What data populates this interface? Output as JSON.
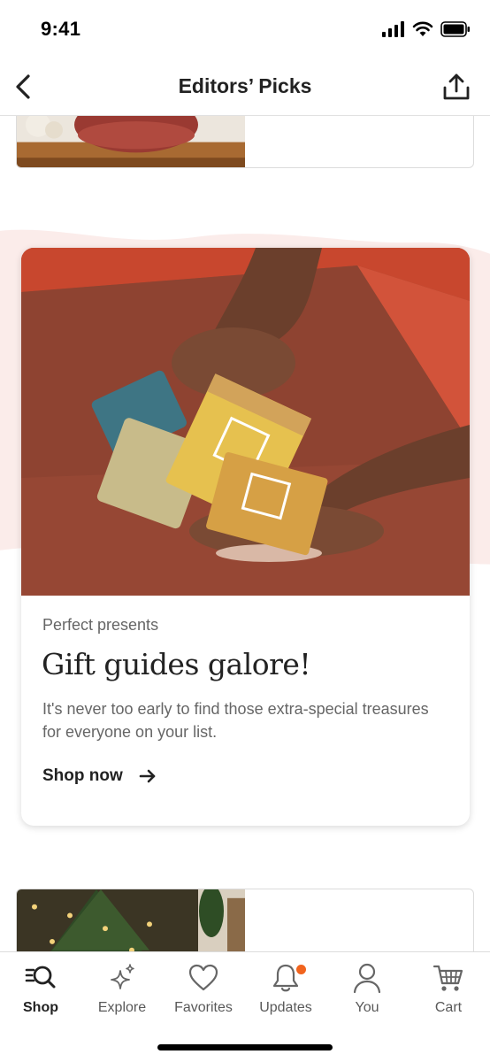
{
  "status_bar": {
    "time": "9:41"
  },
  "header": {
    "title": "Editors’ Picks"
  },
  "feature_card": {
    "eyebrow": "Perfect presents",
    "title": "Gift guides galore!",
    "description": "It's never too early to find those extra-special treasures for everyone on your list.",
    "cta_label": "Shop now"
  },
  "tab_bar": {
    "items": [
      {
        "label": "Shop",
        "icon": "shop-search-icon",
        "active": true
      },
      {
        "label": "Explore",
        "icon": "sparkle-icon",
        "active": false
      },
      {
        "label": "Favorites",
        "icon": "heart-icon",
        "active": false
      },
      {
        "label": "Updates",
        "icon": "bell-icon",
        "active": false,
        "badge": true
      },
      {
        "label": "You",
        "icon": "person-icon",
        "active": false
      },
      {
        "label": "Cart",
        "icon": "cart-icon",
        "active": false
      }
    ]
  },
  "colors": {
    "accent": "#f1641e",
    "text": "#222222",
    "muted": "#666666",
    "blob": "#fbecea"
  }
}
